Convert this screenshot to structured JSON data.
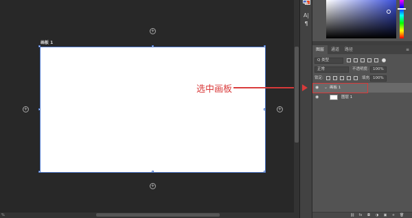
{
  "canvas": {
    "artboard_label": "画板 1",
    "plus_symbol": "+",
    "status_left": "%",
    "annotation": "选中画板"
  },
  "toolstrip": {
    "icons": [
      "swatches-icon",
      "type-icon",
      "paragraph-icon"
    ],
    "glyphs": [
      "⇆",
      "A|",
      "¶"
    ]
  },
  "panel": {
    "tabs": [
      "图层",
      "通道",
      "路径"
    ],
    "menu_glyph": "≡",
    "kind_filter": "Q 类型",
    "blend_mode": "正常",
    "opacity_label": "不透明度:",
    "opacity_value": "100%",
    "lock_label": "锁定:",
    "fill_label": "填充:",
    "fill_value": "100%",
    "layers": [
      {
        "name": "画板 1",
        "selected": true
      },
      {
        "name": "图层 1",
        "selected": false
      }
    ],
    "footer_glyphs": [
      "⛓",
      "fx",
      "◘",
      "◑",
      "▣",
      "+",
      "🗑"
    ]
  },
  "colors": {
    "accent_red": "#d93a3a",
    "artboard_border": "#4d77c9",
    "foreground_swatch": "#2855c5",
    "background_swatch": "#e8421c"
  }
}
